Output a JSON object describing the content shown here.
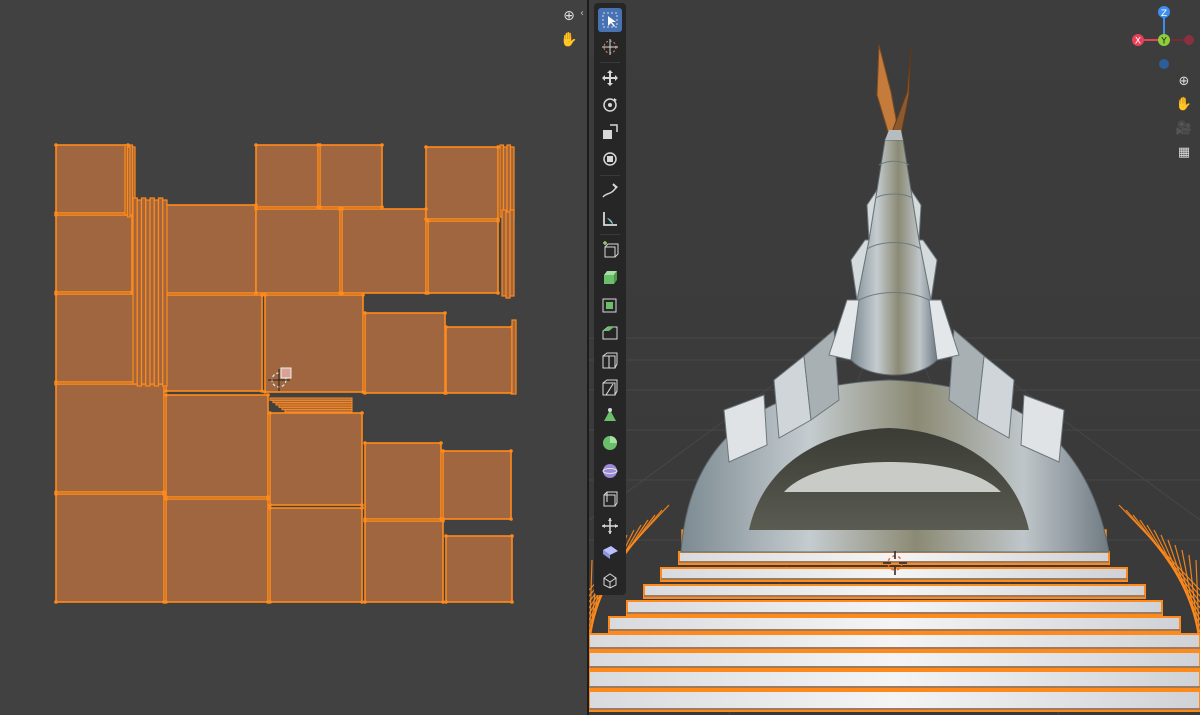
{
  "uv_editor": {
    "tools": [
      {
        "name": "zoom",
        "icon": "magnifier-plus-icon",
        "glyph": "⊕"
      },
      {
        "name": "pan",
        "icon": "hand-icon",
        "glyph": "✋"
      }
    ],
    "accent_color": "#ff8a1c",
    "island_fill": "#a0663f"
  },
  "viewport": {
    "toolbar": [
      {
        "name": "select-box",
        "icon": "cursor-select-icon",
        "active": true
      },
      {
        "name": "cursor",
        "icon": "crosshair-cursor-icon"
      },
      {
        "name": "move",
        "icon": "move-arrows-icon"
      },
      {
        "name": "rotate",
        "icon": "rotate-icon"
      },
      {
        "name": "scale",
        "icon": "scale-icon"
      },
      {
        "name": "transform",
        "icon": "transform-icon"
      },
      {
        "name": "annotate",
        "icon": "pencil-icon"
      },
      {
        "name": "measure",
        "icon": "ruler-icon"
      },
      {
        "name": "add-cube",
        "icon": "add-cube-icon"
      },
      {
        "name": "extrude",
        "icon": "extrude-icon"
      },
      {
        "name": "inset",
        "icon": "inset-faces-icon"
      },
      {
        "name": "bevel",
        "icon": "bevel-icon"
      },
      {
        "name": "loop-cut",
        "icon": "loop-cut-icon"
      },
      {
        "name": "knife",
        "icon": "knife-icon"
      },
      {
        "name": "poly-build",
        "icon": "poly-build-icon"
      },
      {
        "name": "spin",
        "icon": "spin-icon"
      },
      {
        "name": "smooth",
        "icon": "smooth-sphere-icon"
      },
      {
        "name": "edge-slide",
        "icon": "edge-slide-icon"
      },
      {
        "name": "shrink-fatten",
        "icon": "shrink-fatten-icon"
      },
      {
        "name": "shear",
        "icon": "shear-icon"
      },
      {
        "name": "rip-region",
        "icon": "rip-region-icon"
      }
    ],
    "gizmo": {
      "x_label": "X",
      "y_label": "Y",
      "z_label": "Z",
      "x_color": "#e8405a",
      "y_color": "#8ccf3a",
      "z_color": "#3c8ef0"
    },
    "nav_buttons": [
      {
        "name": "zoom",
        "icon": "magnifier-plus-icon",
        "glyph": "⊕"
      },
      {
        "name": "pan",
        "icon": "hand-icon",
        "glyph": "✋"
      },
      {
        "name": "camera",
        "icon": "camera-icon",
        "glyph": "🎥"
      },
      {
        "name": "grid",
        "icon": "grid-icon",
        "glyph": "▦"
      }
    ]
  }
}
